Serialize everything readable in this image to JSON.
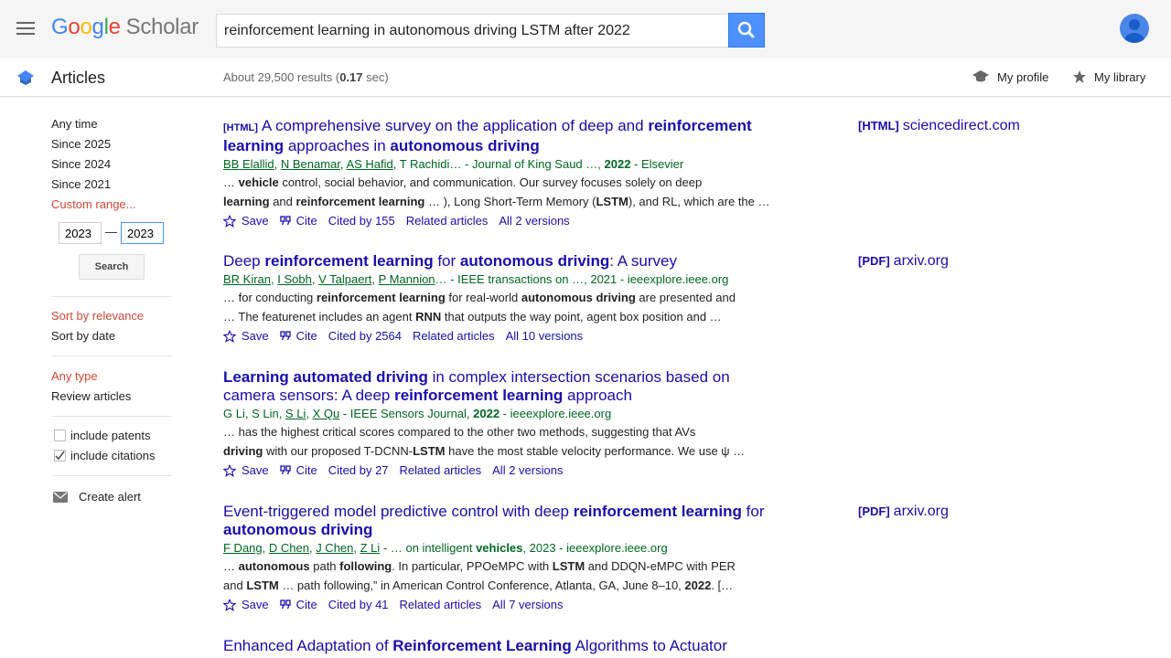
{
  "header": {
    "logo_google": [
      "G",
      "o",
      "o",
      "g",
      "l",
      "e"
    ],
    "logo_scholar": "Scholar",
    "search_value": "reinforcement learning in autonomous driving LSTM after 2022"
  },
  "subbar": {
    "section_label": "Articles",
    "result_prefix": "About 29,500 results (",
    "result_time": "0.17",
    "result_suffix": " sec)",
    "my_profile": "My profile",
    "my_library": "My library"
  },
  "sidebar": {
    "time_filters": [
      "Any time",
      "Since 2025",
      "Since 2024",
      "Since 2021"
    ],
    "custom_range": "Custom range...",
    "year_from": "2023",
    "year_to": "2023",
    "dash": "—",
    "search_button": "Search",
    "sort_relevance": "Sort by relevance",
    "sort_date": "Sort by date",
    "any_type": "Any type",
    "review_articles": "Review articles",
    "include_patents": "include patents",
    "include_citations": "include citations",
    "create_alert": "Create alert"
  },
  "results": [
    {
      "tag": "[HTML]",
      "title_parts": [
        {
          "t": "A comprehensive survey on the application of deep and ",
          "b": false
        },
        {
          "t": "reinforcement learning",
          "b": true
        },
        {
          "t": " approaches in ",
          "b": false
        },
        {
          "t": "autonomous driving",
          "b": true
        }
      ],
      "authors": [
        {
          "t": "BB Elallid",
          "u": true
        },
        {
          "t": ", ",
          "u": false
        },
        {
          "t": "N Benamar",
          "u": true
        },
        {
          "t": ", ",
          "u": false
        },
        {
          "t": "AS Hafid",
          "u": true
        },
        {
          "t": ", T Rachidi… - Journal of King Saud …, ",
          "u": false
        },
        {
          "t": "2022",
          "u": false,
          "b": true
        },
        {
          "t": " - Elsevier",
          "u": false
        }
      ],
      "snippet": [
        [
          {
            "t": "… ",
            "b": false
          },
          {
            "t": "vehicle",
            "b": true
          },
          {
            "t": " control, social behavior, and communication. Our survey focuses solely on deep",
            "b": false
          }
        ],
        [
          {
            "t": "learning",
            "b": true
          },
          {
            "t": " and ",
            "b": false
          },
          {
            "t": "reinforcement learning",
            "b": true
          },
          {
            "t": " … ), Long Short-Term Memory (",
            "b": false
          },
          {
            "t": "LSTM",
            "b": true
          },
          {
            "t": "), and RL, which are the …",
            "b": false
          }
        ]
      ],
      "save": "Save",
      "cite": "Cite",
      "cited_by": "Cited by 155",
      "related": "Related articles",
      "versions": "All 2 versions",
      "side_tag": "[HTML]",
      "side_domain": "sciencedirect.com"
    },
    {
      "tag": "",
      "title_parts": [
        {
          "t": "Deep ",
          "b": false
        },
        {
          "t": "reinforcement learning",
          "b": true
        },
        {
          "t": " for ",
          "b": false
        },
        {
          "t": "autonomous driving",
          "b": true
        },
        {
          "t": ": A survey",
          "b": false
        }
      ],
      "authors": [
        {
          "t": "BR Kiran",
          "u": true
        },
        {
          "t": ", ",
          "u": false
        },
        {
          "t": "I Sobh",
          "u": true
        },
        {
          "t": ", ",
          "u": false
        },
        {
          "t": "V Talpaert",
          "u": true
        },
        {
          "t": ", ",
          "u": false
        },
        {
          "t": "P Mannion",
          "u": true
        },
        {
          "t": "… - IEEE transactions on …, 2021 - ieeexplore.ieee.org",
          "u": false
        }
      ],
      "snippet": [
        [
          {
            "t": "… for conducting ",
            "b": false
          },
          {
            "t": "reinforcement learning",
            "b": true
          },
          {
            "t": " for real-world ",
            "b": false
          },
          {
            "t": "autonomous driving",
            "b": true
          },
          {
            "t": " are presented and",
            "b": false
          }
        ],
        [
          {
            "t": "… The featurenet includes an agent ",
            "b": false
          },
          {
            "t": "RNN",
            "b": true
          },
          {
            "t": " that outputs the way point, agent box position and …",
            "b": false
          }
        ]
      ],
      "save": "Save",
      "cite": "Cite",
      "cited_by": "Cited by 2564",
      "related": "Related articles",
      "versions": "All 10 versions",
      "side_tag": "[PDF]",
      "side_domain": "arxiv.org"
    },
    {
      "tag": "",
      "title_parts": [
        {
          "t": "Learning automated driving",
          "b": true
        },
        {
          "t": " in complex intersection scenarios based on camera sensors: A deep ",
          "b": false
        },
        {
          "t": "reinforcement learning",
          "b": true
        },
        {
          "t": " approach",
          "b": false
        }
      ],
      "authors": [
        {
          "t": "G Li, S Lin, ",
          "u": false
        },
        {
          "t": "S Li",
          "u": true
        },
        {
          "t": ", ",
          "u": false
        },
        {
          "t": "X Qu",
          "u": true
        },
        {
          "t": " - IEEE Sensors Journal, ",
          "u": false
        },
        {
          "t": "2022",
          "u": false,
          "b": true
        },
        {
          "t": " - ieeexplore.ieee.org",
          "u": false
        }
      ],
      "snippet": [
        [
          {
            "t": "… has the highest critical scores compared to the other two methods, suggesting that AVs",
            "b": false
          }
        ],
        [
          {
            "t": "driving",
            "b": true
          },
          {
            "t": " with our proposed T-DCNN-",
            "b": false
          },
          {
            "t": "LSTM",
            "b": true
          },
          {
            "t": " have the most stable velocity performance. We use ψ …",
            "b": false
          }
        ]
      ],
      "save": "Save",
      "cite": "Cite",
      "cited_by": "Cited by 27",
      "related": "Related articles",
      "versions": "All 2 versions",
      "side_tag": "",
      "side_domain": ""
    },
    {
      "tag": "",
      "title_parts": [
        {
          "t": "Event-triggered model predictive control with deep ",
          "b": false
        },
        {
          "t": "reinforcement learning",
          "b": true
        },
        {
          "t": " for ",
          "b": false
        },
        {
          "t": "autonomous driving",
          "b": true
        }
      ],
      "authors": [
        {
          "t": "F Dang",
          "u": true
        },
        {
          "t": ", ",
          "u": false
        },
        {
          "t": "D Chen",
          "u": true
        },
        {
          "t": ", ",
          "u": false
        },
        {
          "t": "J Chen",
          "u": true
        },
        {
          "t": ", ",
          "u": false
        },
        {
          "t": "Z Li",
          "u": true
        },
        {
          "t": " - … on intelligent ",
          "u": false
        },
        {
          "t": "vehicles",
          "u": false,
          "b": true
        },
        {
          "t": ", 2023 - ieeexplore.ieee.org",
          "u": false
        }
      ],
      "snippet": [
        [
          {
            "t": "… ",
            "b": false
          },
          {
            "t": "autonomous",
            "b": true
          },
          {
            "t": " path ",
            "b": false
          },
          {
            "t": "following",
            "b": true
          },
          {
            "t": ". In particular, PPOeMPC with ",
            "b": false
          },
          {
            "t": "LSTM",
            "b": true
          },
          {
            "t": " and DDQN-eMPC with PER",
            "b": false
          }
        ],
        [
          {
            "t": "and ",
            "b": false
          },
          {
            "t": "LSTM",
            "b": true
          },
          {
            "t": " … path following,” in American Control Conference, Atlanta, GA, June 8–10, ",
            "b": false
          },
          {
            "t": "2022",
            "b": true
          },
          {
            "t": ". […",
            "b": false
          }
        ]
      ],
      "save": "Save",
      "cite": "Cite",
      "cited_by": "Cited by 41",
      "related": "Related articles",
      "versions": "All 7 versions",
      "side_tag": "[PDF]",
      "side_domain": "arxiv.org"
    },
    {
      "tag": "",
      "title_parts": [
        {
          "t": "Enhanced Adaptation of ",
          "b": false
        },
        {
          "t": "Reinforcement Learning",
          "b": true
        },
        {
          "t": " Algorithms to Actuator",
          "b": false
        }
      ],
      "authors": [],
      "snippet": [],
      "save": "",
      "cite": "",
      "cited_by": "",
      "related": "",
      "versions": "",
      "side_tag": "",
      "side_domain": ""
    }
  ]
}
